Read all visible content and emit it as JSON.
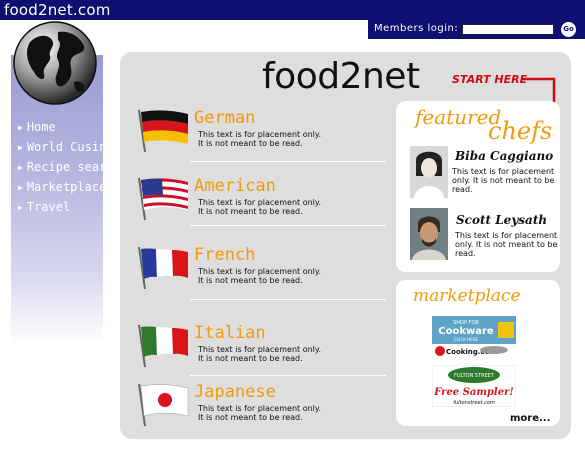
{
  "site": {
    "brand": "food2net.com",
    "logo_text": "food2net"
  },
  "login": {
    "label": "Members login:",
    "go_label": "Go"
  },
  "nav": {
    "items": [
      {
        "label": "Home"
      },
      {
        "label": "World Cusine"
      },
      {
        "label": "Recipe search"
      },
      {
        "label": "Marketplace"
      },
      {
        "label": "Travel"
      }
    ]
  },
  "start_here": "START HERE",
  "cuisines": [
    {
      "name": "German",
      "text": "This text is for placement only. It is not meant to be read."
    },
    {
      "name": "American",
      "text": "This text is for placement only. It is not meant to be read."
    },
    {
      "name": "French",
      "text": "This text is for placement only. It is not meant to be read."
    },
    {
      "name": "Italian",
      "text": "This text is for placement only. It is not meant to be read."
    },
    {
      "name": "Japanese",
      "text": "This text is for placement only. It is not meant to be read."
    }
  ],
  "featured": {
    "word1": "featured",
    "word2": "chefs",
    "chefs": [
      {
        "name": "Biba Caggiano",
        "text": "This text is for placement only. It is not meant to be read."
      },
      {
        "name": "Scott Leysath",
        "text": "This text is for placement only. It is not meant to be read."
      }
    ]
  },
  "marketplace": {
    "title": "marketplace",
    "ads": [
      {
        "line1": "SHOP FOR",
        "line2": "Cookware",
        "line3": "CLICK HERE",
        "brand": "Cooking.com"
      },
      {
        "line1": "FULTON STREET",
        "line2": "Free Sampler!",
        "brand": "fultonstreet.com"
      }
    ],
    "more_label": "more..."
  },
  "colors": {
    "navy": "#0d1070",
    "orange": "#f19a0c",
    "red": "#cc0b12",
    "panel": "#dedede"
  }
}
